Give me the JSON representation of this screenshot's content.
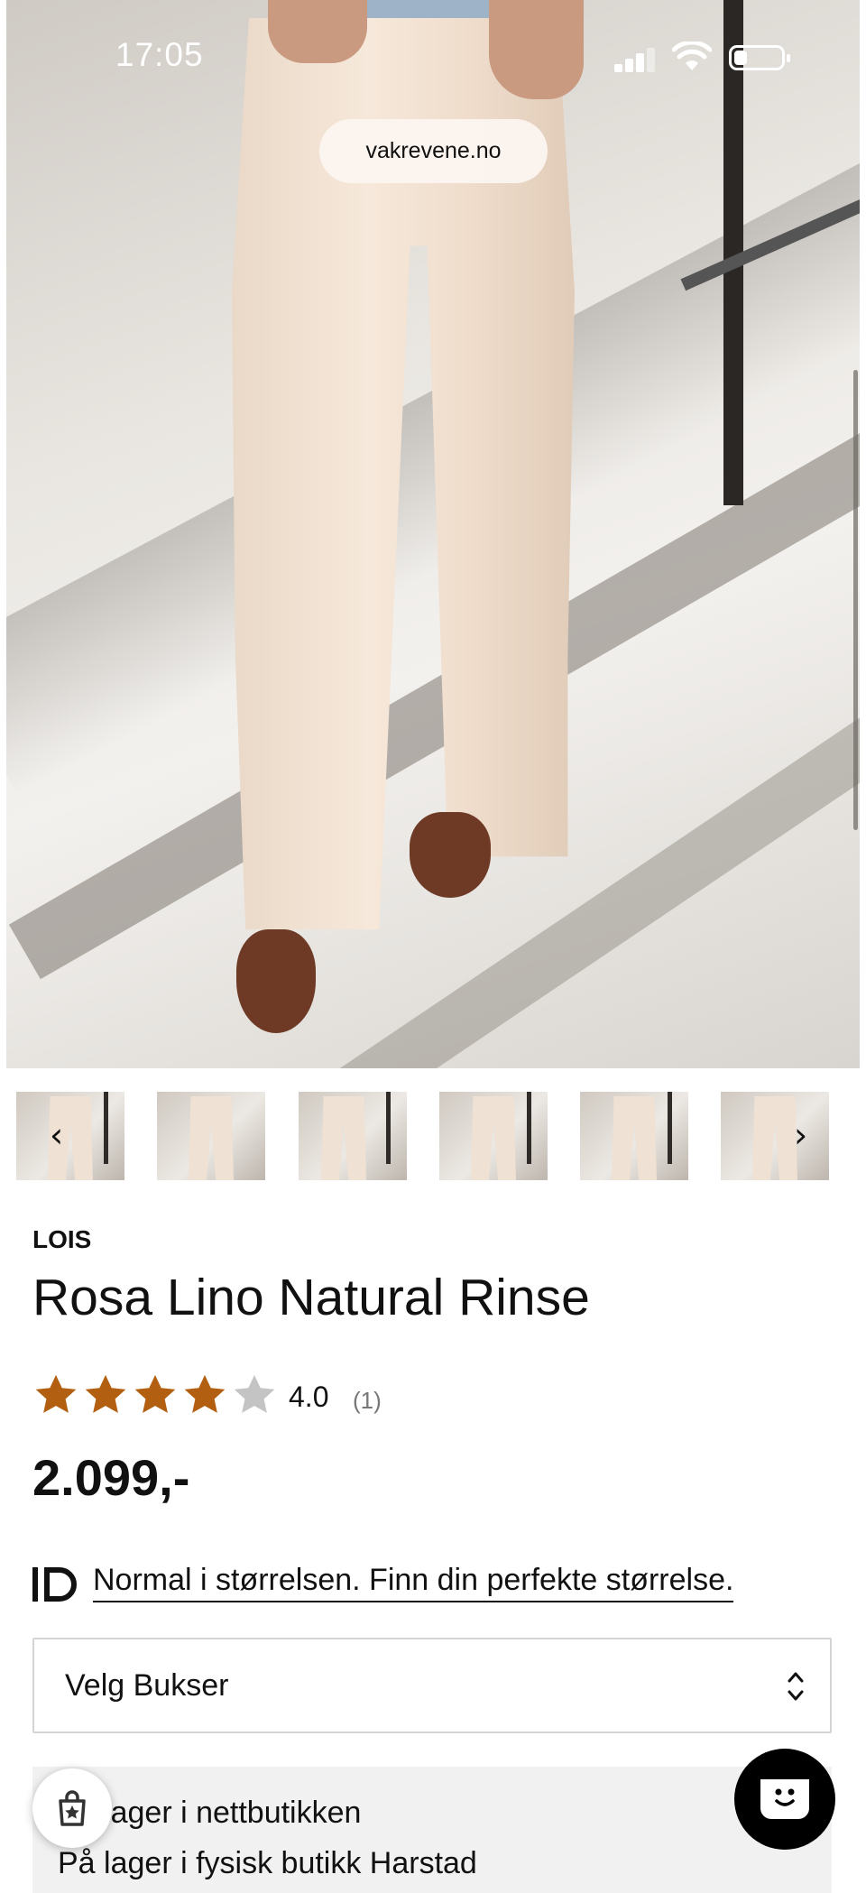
{
  "status_bar": {
    "time": "17:05"
  },
  "browser": {
    "url": "vakrevene.no"
  },
  "gallery": {
    "thumbnail_count": 6,
    "prev_arrow": "‹",
    "next_arrow": "›"
  },
  "product": {
    "brand": "LOIS",
    "title": "Rosa Lino Natural Rinse",
    "rating": {
      "value": "4.0",
      "count": "(1)",
      "stars_filled": 4,
      "stars_total": 5
    },
    "price": "2.099,-",
    "fit_text": "Normal i størrelsen. Finn din perfekte størrelse.",
    "size_select": {
      "selected": "Velg Bukser"
    },
    "stock": {
      "line1": "På lager i nettbutikken",
      "line2": "På lager i fysisk butikk Harstad"
    }
  },
  "colors": {
    "star_filled": "#b35f12",
    "star_empty": "#c4c4c4",
    "text": "#111111"
  },
  "icons": {
    "signal": "cellular-signal-icon",
    "wifi": "wifi-icon",
    "battery": "battery-icon",
    "id": "id-size-logo-icon",
    "wishlist": "star-bag-icon",
    "chat": "chat-face-icon"
  }
}
